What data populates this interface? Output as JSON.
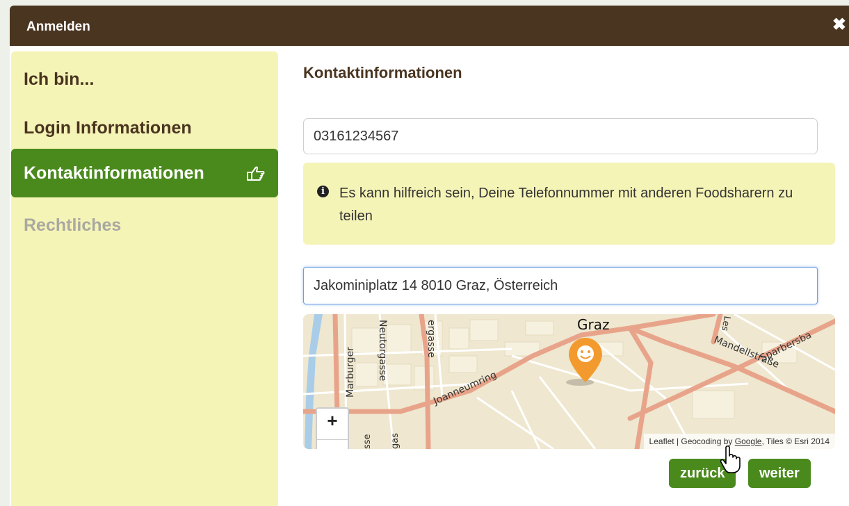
{
  "dialog": {
    "title": "Anmelden",
    "close_icon": "close-icon"
  },
  "sidebar": {
    "items": [
      {
        "label": "Ich bin...",
        "state": "normal"
      },
      {
        "label": "Login Informationen",
        "state": "normal"
      },
      {
        "label": "Kontaktinformationen",
        "state": "active",
        "icon": "hand-pointer-right-icon"
      },
      {
        "label": "Rechtliches",
        "state": "disabled"
      }
    ]
  },
  "main": {
    "heading": "Kontaktinformationen",
    "phone_value": "03161234567",
    "info": {
      "icon": "info-circle-icon",
      "text": "Es kann hilfreich sein, Deine Telefonnummer mit anderen Foodsharern zu teilen"
    },
    "address_value": "Jakominiplatz 14 8010 Graz, Österreich",
    "map": {
      "labels": {
        "city": "Graz",
        "marburger": "Marburger",
        "neutorgasse": "Neutorgasse",
        "ergasse": "ergasse",
        "joanneumring": "Joanneumring",
        "mandellstrasse": "Mandellstraße",
        "sparbersbach": "Sparbersba",
        "les": "Les",
        "sse": "sse",
        "gasse_bottom": "gas"
      },
      "zoom_in": "+",
      "attribution_prefix": "Leaflet | Geocoding by ",
      "attribution_link": "Google",
      "attribution_suffix": ", Tiles © Esri 2014",
      "marker_icon": "smiley-marker-icon"
    },
    "buttons": {
      "back": "zurück",
      "next": "weiter"
    }
  },
  "colors": {
    "titlebar": "#4a3520",
    "sidebar_bg": "#f5f4b7",
    "active_green": "#4a8a1d",
    "marker_orange": "#f39a2e",
    "road": "#e8a48a"
  }
}
